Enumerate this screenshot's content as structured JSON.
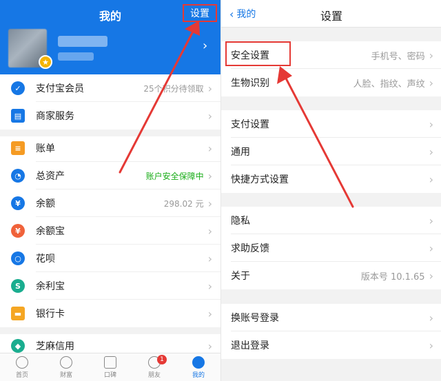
{
  "left": {
    "title": "我的",
    "settings_label": "设置",
    "header_chevron": "›",
    "rows": [
      {
        "label": "支付宝会员",
        "value": "25个积分待领取",
        "icon_color": "#1677e5",
        "icon": "member-icon"
      },
      {
        "label": "商家服务",
        "value": "",
        "icon_color": "#1677e5",
        "icon": "merchant-icon"
      },
      {
        "label": "账单",
        "value": "",
        "icon_color": "#f59b23",
        "icon": "bill-icon"
      },
      {
        "label": "总资产",
        "value": "账户安全保障中",
        "icon_color": "#1677e5",
        "icon": "assets-icon"
      },
      {
        "label": "余额",
        "value": "298.02 元",
        "icon_color": "#1677e5",
        "icon": "balance-icon"
      },
      {
        "label": "余额宝",
        "value": "",
        "icon_color": "#f0623a",
        "icon": "yuebao-icon"
      },
      {
        "label": "花呗",
        "value": "",
        "icon_color": "#1677e5",
        "icon": "huabei-icon"
      },
      {
        "label": "余利宝",
        "value": "",
        "icon_color": "#1aad8f",
        "icon": "yulibao-icon"
      },
      {
        "label": "银行卡",
        "value": "",
        "icon_color": "#f5a623",
        "icon": "bank-card-icon"
      },
      {
        "label": "芝麻信用",
        "value": "",
        "icon_color": "#1aad8f",
        "icon": "sesame-icon"
      }
    ],
    "tabs": [
      {
        "label": "首页",
        "active": false
      },
      {
        "label": "财富",
        "active": false
      },
      {
        "label": "口碑",
        "active": false
      },
      {
        "label": "朋友",
        "active": false,
        "badge": "1"
      },
      {
        "label": "我的",
        "active": true
      }
    ]
  },
  "right": {
    "back_label": "我的",
    "title": "设置",
    "rows": [
      {
        "label": "安全设置",
        "value": "手机号、密码"
      },
      {
        "label": "生物识别",
        "value": "人脸、指纹、声纹"
      },
      {
        "label": "支付设置",
        "value": ""
      },
      {
        "label": "通用",
        "value": ""
      },
      {
        "label": "快捷方式设置",
        "value": ""
      },
      {
        "label": "隐私",
        "value": ""
      },
      {
        "label": "求助反馈",
        "value": ""
      },
      {
        "label": "关于",
        "value": "版本号 10.1.65"
      },
      {
        "label": "换账号登录",
        "value": ""
      },
      {
        "label": "退出登录",
        "value": ""
      }
    ]
  },
  "colors": {
    "brand": "#1677e5",
    "highlight": "#e53935",
    "safe_green": "#1aad19"
  },
  "chevron": "›"
}
